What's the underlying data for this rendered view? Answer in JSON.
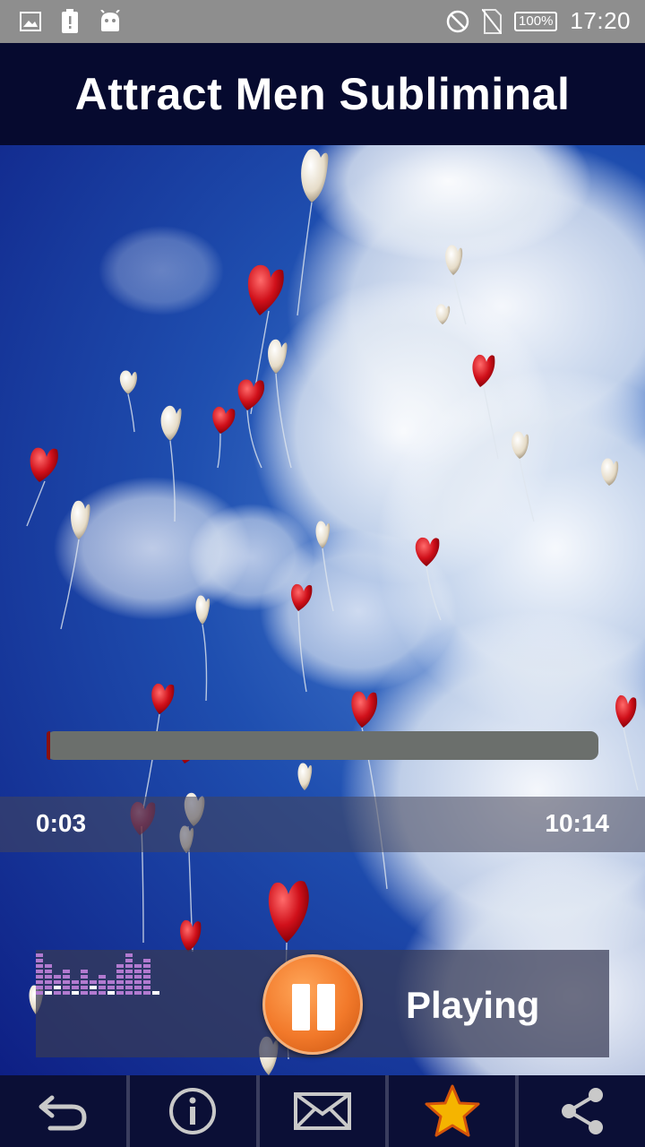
{
  "status_bar": {
    "icons": [
      "gallery-icon",
      "battery-alert-icon",
      "android-icon"
    ],
    "right_icons": [
      "do-not-disturb-icon",
      "no-sim-icon"
    ],
    "battery": "100%",
    "time": "17:20"
  },
  "header": {
    "title": "Attract Men Subliminal"
  },
  "player": {
    "elapsed": "0:03",
    "duration": "10:14",
    "progress_fraction": 0.005,
    "state_label": "Playing",
    "play_button_icon": "pause-icon",
    "visualizer_icon": "equalizer-icon"
  },
  "bottom_nav": [
    {
      "icon": "back-arrow-icon"
    },
    {
      "icon": "info-icon"
    },
    {
      "icon": "mail-icon"
    },
    {
      "icon": "star-icon"
    },
    {
      "icon": "share-icon"
    }
  ],
  "colors": {
    "header_bg": "#060a2f",
    "accent_orange": "#f2792a",
    "bottom_bar_bg": "#0b0f36",
    "star_gold": "#f5b400"
  }
}
